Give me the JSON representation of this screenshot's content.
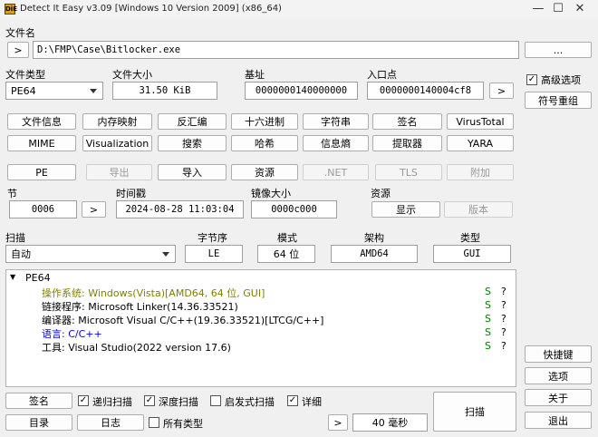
{
  "window": {
    "title": "Detect It Easy v3.09 [Windows 10 Version 2009] (x86_64)",
    "icon_text": "DiE",
    "minimize": "—",
    "maximize": "☐",
    "close": "✕"
  },
  "file": {
    "label": "文件名",
    "open_arrow": ">",
    "path": "D:\\FMP\\Case\\Bitlocker.exe",
    "browse": "..."
  },
  "info": {
    "type_label": "文件类型",
    "type_value": "PE64",
    "size_label": "文件大小",
    "size_value": "31.50 KiB",
    "base_label": "基址",
    "base_value": "0000000140000000",
    "entry_label": "入口点",
    "entry_value": "0000000140004cf8",
    "entry_arrow": ">"
  },
  "advanced": {
    "checked": true,
    "label": "高级选项",
    "symbols": "符号重组"
  },
  "tools_row1": [
    "文件信息",
    "内存映射",
    "反汇编",
    "十六进制",
    "字符串",
    "签名",
    "VirusTotal"
  ],
  "tools_row2": [
    "MIME",
    "Visualization",
    "搜索",
    "哈希",
    "信息熵",
    "提取器",
    "YARA"
  ],
  "pe_row": {
    "pe": "PE",
    "export": "导出",
    "import": "导入",
    "resources": "资源",
    "net": ".NET",
    "tls": "TLS",
    "overlay": "附加"
  },
  "sections": {
    "section_label": "节",
    "section_value": "0006",
    "section_arrow": ">",
    "time_label": "时间戳",
    "time_value": "2024-08-28 11:03:04",
    "image_label": "镜像大小",
    "image_value": "0000c000",
    "res_label": "资源",
    "res_show": "显示",
    "res_version": "版本"
  },
  "scan": {
    "label": "扫描",
    "mode_value": "自动",
    "endian_label": "字节序",
    "endian_value": "LE",
    "mode_label": "模式",
    "bits_value": "64 位",
    "arch_label": "架构",
    "arch_value": "AMD64",
    "type_label": "类型",
    "type_value": "GUI"
  },
  "results": {
    "root": "PE64",
    "expander": "▼",
    "items": [
      {
        "text": "操作系统: Windows(Vista)[AMD64, 64 位, GUI]",
        "s": "S",
        "q": "?",
        "color": "#808000"
      },
      {
        "text": "链接程序: Microsoft Linker(14.36.33521)",
        "s": "S",
        "q": "?",
        "color": "#000000"
      },
      {
        "text": "编译器: Microsoft Visual C/C++(19.36.33521)[LTCG/C++]",
        "s": "S",
        "q": "?",
        "color": "#000000"
      },
      {
        "text": "语言: C/C++",
        "s": "S",
        "q": "?",
        "color": "#0000ff"
      },
      {
        "text": "工具: Visual Studio(2022 version 17.6)",
        "s": "S",
        "q": "?",
        "color": "#000000"
      }
    ],
    "s_color": "#008000"
  },
  "bottom": {
    "sig": "签名",
    "recursive": "递归扫描",
    "deep": "深度扫描",
    "heuristic": "启发式扫描",
    "verbose": "详细",
    "dir": "目录",
    "log": "日志",
    "all_types": "所有类型",
    "arrow": ">",
    "time": "40 毫秒",
    "scan": "扫描",
    "recursive_checked": true,
    "deep_checked": true,
    "heuristic_checked": false,
    "verbose_checked": true,
    "all_types_checked": false
  },
  "side": {
    "shortcuts": "快捷键",
    "options": "选项",
    "about": "关于",
    "exit": "退出"
  }
}
